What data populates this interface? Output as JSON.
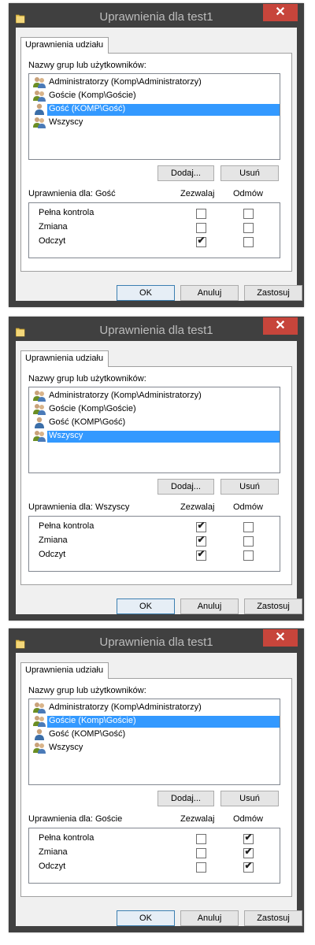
{
  "dialogs": [
    {
      "title": "Uprawnienia dla test1",
      "close": "✕",
      "tab": "Uprawnienia udziału",
      "groups_label": "Nazwy grup lub użytkowników:",
      "users": [
        {
          "label": "Administratorzy (Komp\\Administratorzy)",
          "icon": "group-icon",
          "selected": false
        },
        {
          "label": "Goście (Komp\\Goście)",
          "icon": "group-icon",
          "selected": false
        },
        {
          "label": "Gość (KOMP\\Gość)",
          "icon": "user-icon",
          "selected": true
        },
        {
          "label": "Wszyscy",
          "icon": "group-icon",
          "selected": false
        }
      ],
      "add_button": "Dodaj...",
      "remove_button": "Usuń",
      "perm_label": "Uprawnienia dla: Gość",
      "allow_header": "Zezwalaj",
      "deny_header": "Odmów",
      "permissions": [
        {
          "name": "Pełna kontrola",
          "allow": false,
          "deny": false
        },
        {
          "name": "Zmiana",
          "allow": false,
          "deny": false
        },
        {
          "name": "Odczyt",
          "allow": true,
          "deny": false
        }
      ],
      "ok": "OK",
      "cancel": "Anuluj",
      "apply": "Zastosuj"
    },
    {
      "title": "Uprawnienia dla test1",
      "close": "✕",
      "tab": "Uprawnienia udziału",
      "groups_label": "Nazwy grup lub użytkowników:",
      "users": [
        {
          "label": "Administratorzy (Komp\\Administratorzy)",
          "icon": "group-icon",
          "selected": false
        },
        {
          "label": "Goście (Komp\\Goście)",
          "icon": "group-icon",
          "selected": false
        },
        {
          "label": "Gość (KOMP\\Gość)",
          "icon": "user-icon",
          "selected": false
        },
        {
          "label": "Wszyscy",
          "icon": "group-icon",
          "selected": true
        }
      ],
      "add_button": "Dodaj...",
      "remove_button": "Usuń",
      "perm_label": "Uprawnienia dla: Wszyscy",
      "allow_header": "Zezwalaj",
      "deny_header": "Odmów",
      "permissions": [
        {
          "name": "Pełna kontrola",
          "allow": true,
          "deny": false
        },
        {
          "name": "Zmiana",
          "allow": true,
          "deny": false
        },
        {
          "name": "Odczyt",
          "allow": true,
          "deny": false
        }
      ],
      "ok": "OK",
      "cancel": "Anuluj",
      "apply": "Zastosuj"
    },
    {
      "title": "Uprawnienia dla test1",
      "close": "✕",
      "tab": "Uprawnienia udziału",
      "groups_label": "Nazwy grup lub użytkowników:",
      "users": [
        {
          "label": "Administratorzy (Komp\\Administratorzy)",
          "icon": "group-icon",
          "selected": false
        },
        {
          "label": "Goście (Komp\\Goście)",
          "icon": "group-icon",
          "selected": true
        },
        {
          "label": "Gość (KOMP\\Gość)",
          "icon": "user-icon",
          "selected": false
        },
        {
          "label": "Wszyscy",
          "icon": "group-icon",
          "selected": false
        }
      ],
      "add_button": "Dodaj...",
      "remove_button": "Usuń",
      "perm_label": "Uprawnienia dla: Goście",
      "allow_header": "Zezwalaj",
      "deny_header": "Odmów",
      "permissions": [
        {
          "name": "Pełna kontrola",
          "allow": false,
          "deny": true
        },
        {
          "name": "Zmiana",
          "allow": false,
          "deny": true
        },
        {
          "name": "Odczyt",
          "allow": false,
          "deny": true
        }
      ],
      "ok": "OK",
      "cancel": "Anuluj",
      "apply": "Zastosuj"
    }
  ],
  "colors": {
    "titlebar": "#404040",
    "close": "#c7453b",
    "selection": "#3399ff",
    "client": "#f0f0f0"
  },
  "check_glyph": "✔"
}
